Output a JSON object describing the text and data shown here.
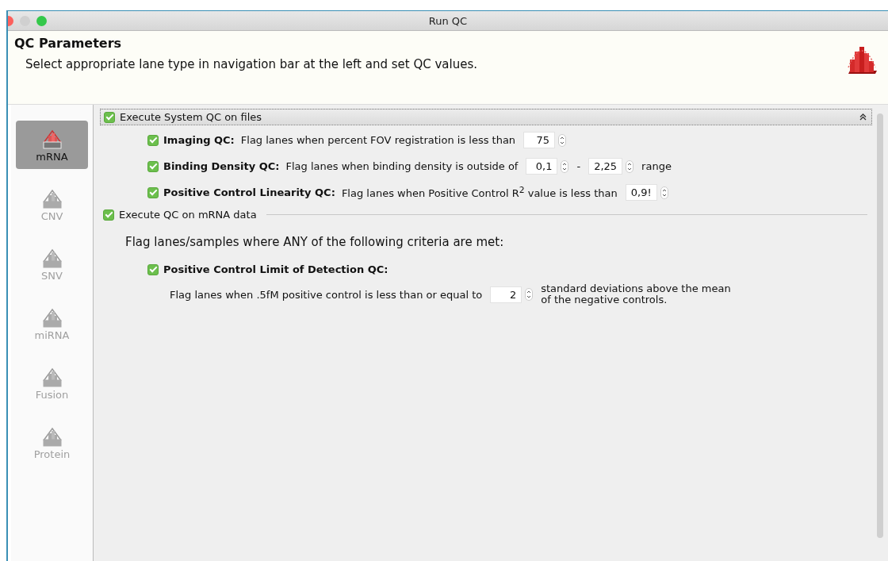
{
  "window": {
    "title": "Run QC"
  },
  "header": {
    "title": "QC Parameters",
    "subtitle": "Select appropriate lane type in navigation bar at the left and set QC values."
  },
  "sidebar": {
    "items": [
      {
        "label": "mRNA",
        "selected": true,
        "disabled": false
      },
      {
        "label": "CNV",
        "selected": false,
        "disabled": true
      },
      {
        "label": "SNV",
        "selected": false,
        "disabled": true
      },
      {
        "label": "miRNA",
        "selected": false,
        "disabled": true
      },
      {
        "label": "Fusion",
        "selected": false,
        "disabled": true
      },
      {
        "label": "Protein",
        "selected": false,
        "disabled": true
      }
    ]
  },
  "sections": [
    {
      "kind": "collapsible",
      "label": "Execute System QC on files",
      "checked": true,
      "expanded": true,
      "items": [
        {
          "title": "Imaging QC:",
          "checked": true,
          "kind": "inline",
          "parts": [
            {
              "kind": "text",
              "text": "Flag lanes when percent FOV registration is less than"
            },
            {
              "kind": "spinner",
              "value": "75"
            }
          ]
        },
        {
          "title": "Binding Density QC:",
          "checked": true,
          "kind": "inline",
          "parts": [
            {
              "kind": "text",
              "text": "Flag lanes when binding density is outside of"
            },
            {
              "kind": "spinner",
              "value": "0,1"
            },
            {
              "kind": "text",
              "text": "-"
            },
            {
              "kind": "spinner",
              "value": "2,25"
            },
            {
              "kind": "text",
              "text": "range"
            }
          ]
        },
        {
          "title": "Positive Control Linearity QC:",
          "checked": true,
          "kind": "inline",
          "parts": [
            {
              "kind": "text",
              "text": "Flag lanes when Positive Control R$^{2}$ value is less than"
            },
            {
              "kind": "spinner",
              "value": "0,9!"
            }
          ]
        }
      ]
    },
    {
      "kind": "separator",
      "label": "Execute QC on mRNA data",
      "checked": true,
      "intro": "Flag lanes/samples where ANY of the following criteria are met:",
      "items": [
        {
          "title": "Positive Control Limit of Detection QC:",
          "checked": true,
          "kind": "block",
          "parts": [
            {
              "kind": "text",
              "text": "Flag lanes when .5fM positive control is less than or equal to"
            },
            {
              "kind": "spinner",
              "value": "2"
            },
            {
              "kind": "note",
              "text": "standard deviations above the mean of the negative controls."
            }
          ]
        }
      ]
    }
  ]
}
